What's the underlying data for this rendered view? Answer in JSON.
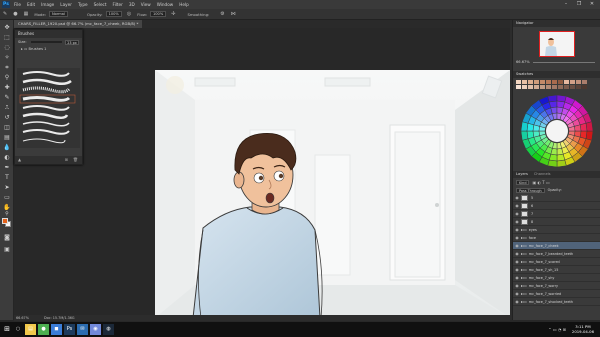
{
  "menubar": {
    "logo": "Ps",
    "items": [
      "File",
      "Edit",
      "Image",
      "Layer",
      "Type",
      "Select",
      "Filter",
      "3D",
      "View",
      "Window",
      "Help"
    ],
    "window_controls": [
      "–",
      "❐",
      "✕"
    ]
  },
  "options_bar": {
    "mode_label": "Mode:",
    "mode_value": "Normal",
    "opacity_label": "Opacity:",
    "opacity_value": "100%",
    "flow_label": "Flow:",
    "flow_value": "100%",
    "smoothing_label": "Smoothing:"
  },
  "document": {
    "tab_title": "CHARS_FILLER_1920.psd @ 66.7% (mc_face_7_cheek, RGB/8) *"
  },
  "brush_panel": {
    "title": "Brushes",
    "size_label": "Size:",
    "size_value": "23 px",
    "folder_label": "Brushes 1"
  },
  "navigator": {
    "tab": "Navigator",
    "zoom": "66.67%"
  },
  "swatches": {
    "tab": "Swatches",
    "colors": [
      "#f3d5c0",
      "#e8c1a6",
      "#dcae8f",
      "#cf9c7b",
      "#c48a69",
      "#b87a5a",
      "#a96b4e",
      "#8e5a41",
      "#e6b8a0",
      "#d4a088",
      "#c2907a",
      "#a97d6c",
      "#f5e0d2",
      "#ecd0bd",
      "#e0bfa9",
      "#d2ad96",
      "#c49c85",
      "#b48b76",
      "#a37a67",
      "#8f6a59",
      "#7b5b4d",
      "#6b4e43",
      "#5a4239",
      "#4b372f"
    ]
  },
  "layers": {
    "tabs": [
      "Layers",
      "Channels"
    ],
    "kind_label": "Kind",
    "blend_value": "Pass Through",
    "opacity_label": "Opacity:",
    "items": [
      {
        "name": "5",
        "type": "layer",
        "selected": false
      },
      {
        "name": "6",
        "type": "layer",
        "selected": false
      },
      {
        "name": "7",
        "type": "layer",
        "selected": false
      },
      {
        "name": "8",
        "type": "layer",
        "selected": false
      },
      {
        "name": "eyes",
        "type": "folder",
        "selected": false
      },
      {
        "name": "face",
        "type": "folder",
        "selected": false
      },
      {
        "name": "mc_face_7_cheek",
        "type": "folder",
        "selected": true
      },
      {
        "name": "mc_face_7_bearded_teeth",
        "type": "folder",
        "selected": false
      },
      {
        "name": "mc_face_7_scared",
        "type": "folder",
        "selected": false
      },
      {
        "name": "mc_face_7_sh_15",
        "type": "folder",
        "selected": false
      },
      {
        "name": "mc_face_7_shy",
        "type": "folder",
        "selected": false
      },
      {
        "name": "mc_face_7_worry",
        "type": "folder",
        "selected": false
      },
      {
        "name": "mc_face_7_worried",
        "type": "folder",
        "selected": false
      },
      {
        "name": "mc_face_7_shocked_teeth",
        "type": "folder",
        "selected": false
      }
    ]
  },
  "status": {
    "zoom": "66.67%",
    "doc": "Doc: 15.7M/1.36G"
  },
  "taskbar": {
    "start": "⊞",
    "apps": [
      {
        "name": "file-explorer",
        "glyph": "▤",
        "color": "#f2c94c"
      },
      {
        "name": "chrome",
        "glyph": "●",
        "color": "#4caf50"
      },
      {
        "name": "store",
        "glyph": "◼",
        "color": "#3b7dd8"
      },
      {
        "name": "photoshop",
        "glyph": "Ps",
        "color": "#1c3a5c"
      },
      {
        "name": "mail",
        "glyph": "✉",
        "color": "#2b6cb0"
      },
      {
        "name": "discord",
        "glyph": "◉",
        "color": "#7289da"
      },
      {
        "name": "steam",
        "glyph": "◍",
        "color": "#1b2838"
      }
    ],
    "time": "3:11 PM",
    "date": "2019-04-06"
  }
}
